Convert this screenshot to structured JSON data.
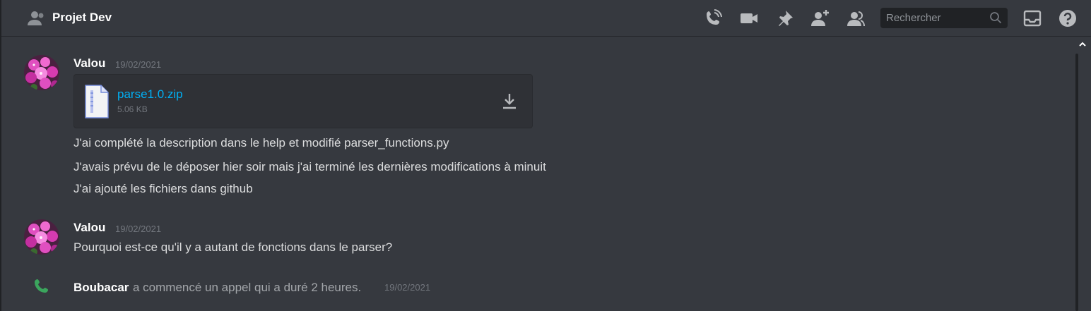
{
  "header": {
    "channel_title": "Projet Dev",
    "search_placeholder": "Rechercher",
    "icons": [
      "people-icon",
      "call-icon",
      "video-icon",
      "pin-icon",
      "add-friend-icon",
      "members-icon",
      "search-icon",
      "inbox-icon",
      "help-icon"
    ]
  },
  "messages": [
    {
      "author": "Valou",
      "timestamp": "19/02/2021",
      "attachment": {
        "filename": "parse1.0.zip",
        "size": "5.06 KB"
      },
      "lines": [
        "J'ai complété la description dans le help et modifié parser_functions.py",
        "J'avais prévu de le déposer hier soir mais j'ai terminé les dernières modifications à minuit",
        "J'ai ajouté les fichiers dans github"
      ]
    },
    {
      "author": "Valou",
      "timestamp": "19/02/2021",
      "lines": [
        "Pourquoi est-ce qu'il y a autant de fonctions dans le parser?"
      ]
    }
  ],
  "system_message": {
    "author": "Boubacar",
    "text": "a commencé un appel qui a duré 2 heures.",
    "timestamp": "19/02/2021"
  },
  "colors": {
    "background": "#36393f",
    "link": "#00aff4",
    "call_green": "#3ba55d",
    "avatar_pink": "#d63bb0"
  }
}
